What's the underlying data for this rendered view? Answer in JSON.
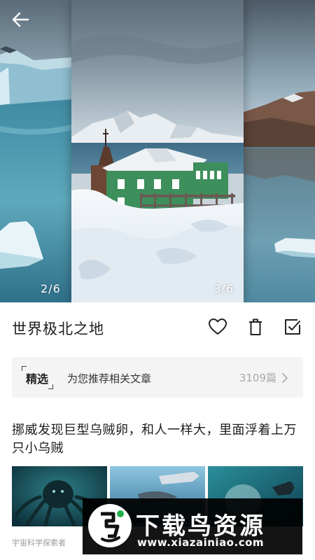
{
  "gallery": {
    "left_counter": "2/6",
    "center_counter": "3/6"
  },
  "detail": {
    "title": "世界极北之地"
  },
  "recommend": {
    "badge": "精选",
    "text": "为您推荐相关文章",
    "count": "3109篇"
  },
  "article": {
    "title": "挪威发现巨型乌贼卵，和人一样大，里面浮着上万只小乌贼",
    "source": "宇宙科学探索者"
  },
  "watermark": {
    "main": "下载鸟资源",
    "url": "www.xiazainiao.com"
  },
  "icons": [
    "back-arrow-icon",
    "heart-icon",
    "trash-icon",
    "checkbox-icon",
    "chevron-right-icon",
    "bird-logo-icon"
  ],
  "colors": {
    "accent_house": "#3d8f5c",
    "card_bg": "#f4f4f4",
    "muted_text": "#a9a9a9"
  }
}
